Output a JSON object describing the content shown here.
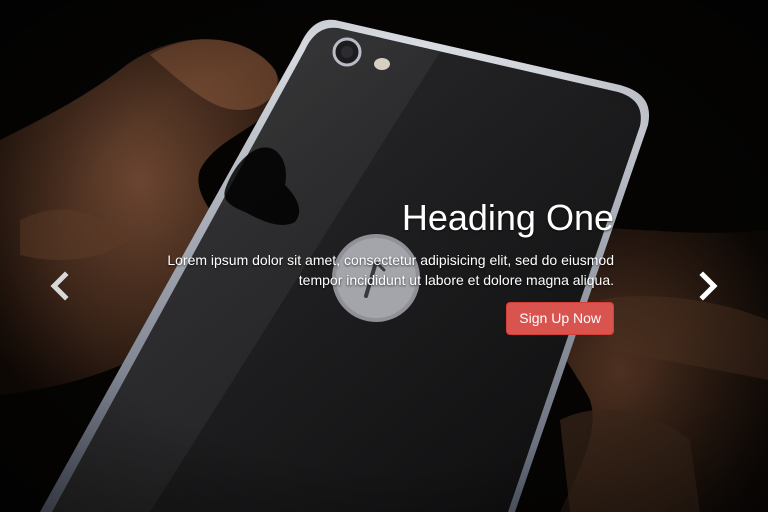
{
  "slide": {
    "heading": "Heading One",
    "text_line_1": "Lorem ipsum dolor sit amet, consectetur adipisicing elit, sed do eiusmod",
    "text_line_2": "tempor incididunt ut labore et dolore magna aliqua.",
    "button_label": "Sign Up Now",
    "image": "smartphone-on-driftwood"
  },
  "controls": {
    "prev_icon": "chevron-left-icon",
    "next_icon": "chevron-right-icon"
  },
  "colors": {
    "button_bg": "#d9534f",
    "text": "#ffffff",
    "background": "#050505"
  }
}
